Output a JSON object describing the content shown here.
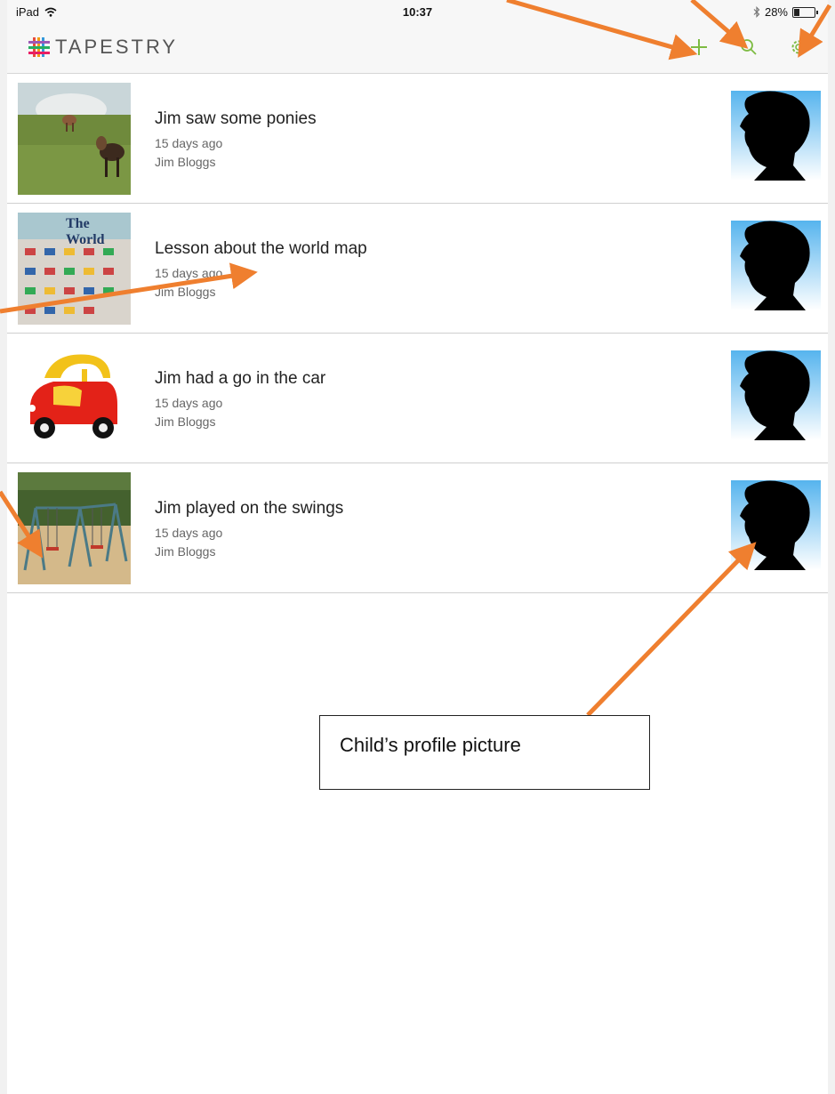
{
  "status_bar": {
    "device": "iPad",
    "time": "10:37",
    "battery_percent": "28%",
    "battery_level": 0.28,
    "icons": [
      "wifi-icon",
      "bluetooth-icon",
      "battery-icon"
    ]
  },
  "header": {
    "app_name": "TAPESTRY",
    "actions": [
      "add-icon",
      "search-icon",
      "settings-gear-icon"
    ],
    "accent_color": "#7dbb42"
  },
  "feed": {
    "items": [
      {
        "title": "Jim saw some ponies",
        "time": "15 days ago",
        "author": "Jim Bloggs",
        "thumbnail": "ponies-photo"
      },
      {
        "title": "Lesson about the world map",
        "time": "15 days ago",
        "author": "Jim Bloggs",
        "thumbnail": "world-map-photo",
        "thumb_caption": "The World"
      },
      {
        "title": "Jim had a go in the car",
        "time": "15 days ago",
        "author": "Jim Bloggs",
        "thumbnail": "toy-car-photo"
      },
      {
        "title": "Jim played on the swings",
        "time": "15 days ago",
        "author": "Jim Bloggs",
        "thumbnail": "swings-photo"
      }
    ]
  },
  "annotation": {
    "callout_text": "Child’s profile picture",
    "arrow_color": "#ef7f2f"
  }
}
